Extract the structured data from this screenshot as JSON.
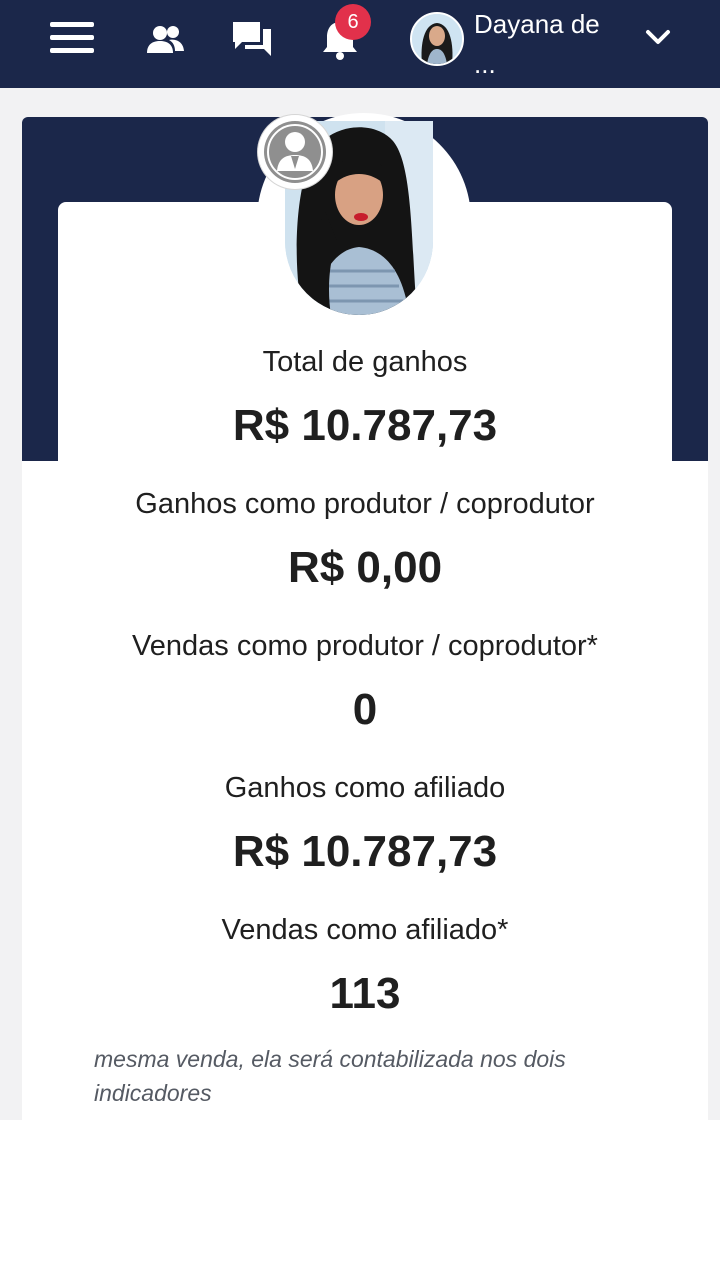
{
  "nav": {
    "menu_icon": "hamburger-menu-icon",
    "users_icon": "users-icon",
    "chat_icon": "chat-icon",
    "bell_icon": "bell-icon",
    "notification_count": "6",
    "user_name": "Dayana de ...",
    "dropdown_icon": "chevron-down-icon"
  },
  "profile": {
    "role_icon": "user-role-icon"
  },
  "stats": [
    {
      "label": "Total de ganhos",
      "value": "R$ 10.787,73"
    },
    {
      "label": "Ganhos como produtor / coprodutor",
      "value": "R$ 0,00"
    },
    {
      "label": "Vendas como produtor / coprodutor*",
      "value": "0"
    },
    {
      "label": "Ganhos como afiliado",
      "value": "R$ 10.787,73"
    },
    {
      "label": "Vendas como afiliado*",
      "value": "113"
    }
  ],
  "footnote": "mesma venda, ela será contabilizada nos dois indicadores",
  "colors": {
    "nav_bg": "#1b274a",
    "badge": "#e2314b",
    "page_bg": "#f2f2f3"
  }
}
